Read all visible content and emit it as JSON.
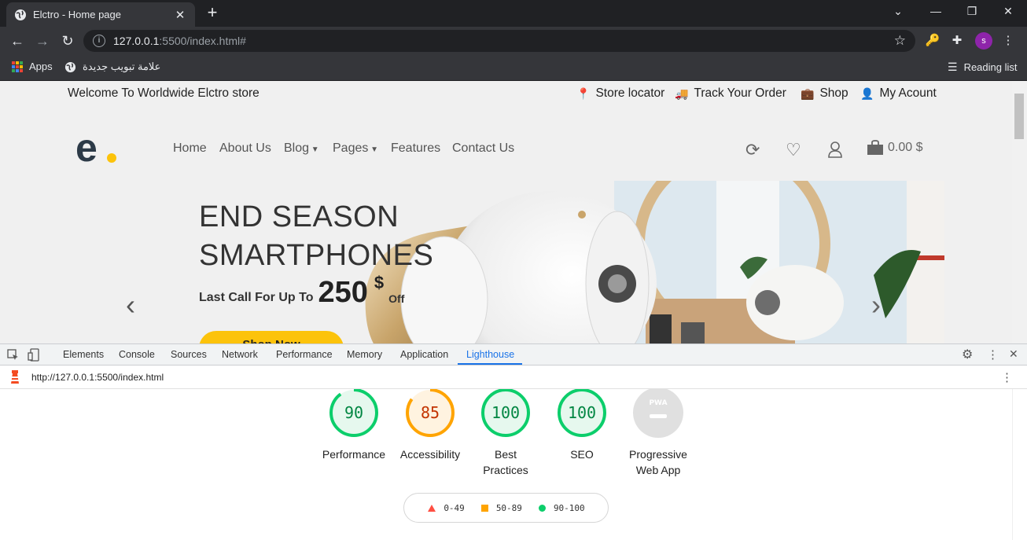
{
  "browser": {
    "tab_title": "Elctro - Home page",
    "url_host": "127.0.0.1",
    "url_path": ":5500/index.html#",
    "bookmarks": {
      "apps": "Apps",
      "bookmark1": "علامة تبويب جديدة",
      "reading_list": "Reading list"
    },
    "avatar_letter": "s"
  },
  "site": {
    "welcome": "Welcome To Worldwide Elctro store",
    "top_links": [
      "Store locator",
      "Track Your Order",
      "Shop",
      "My Acount"
    ],
    "nav": [
      "Home",
      "About Us",
      "Blog",
      "Pages",
      "Features",
      "Contact Us"
    ],
    "cart_total": "0.00 $",
    "hero": {
      "line1": "END SEASON",
      "line2": "SMARTPHONES",
      "sub_label": "Last Call For Up To",
      "price": "250",
      "currency": "$",
      "off": "Off",
      "button": "Shop Now"
    }
  },
  "devtools": {
    "tabs": [
      "Elements",
      "Console",
      "Sources",
      "Network",
      "Performance",
      "Memory",
      "Application",
      "Lighthouse"
    ],
    "active_tab": "Lighthouse",
    "report_url": "http://127.0.0.1:5500/index.html",
    "scores": [
      {
        "value": "90",
        "label": "Performance",
        "color": "#0cce6b"
      },
      {
        "value": "85",
        "label": "Accessibility",
        "color": "#ffa400"
      },
      {
        "value": "100",
        "label": "Best Practices",
        "color": "#0cce6b"
      },
      {
        "value": "100",
        "label": "SEO",
        "color": "#0cce6b"
      },
      {
        "value": "",
        "label": "Progressive Web App",
        "color": "#cccccc"
      }
    ],
    "pwa_badge": "PWA",
    "legend": [
      {
        "range": "0-49",
        "color": "#ff4e42"
      },
      {
        "range": "50-89",
        "color": "#ffa400"
      },
      {
        "range": "90-100",
        "color": "#0cce6b"
      }
    ]
  },
  "colors": {
    "accent": "#fcc30b",
    "devtools_active": "#1a73e8"
  }
}
